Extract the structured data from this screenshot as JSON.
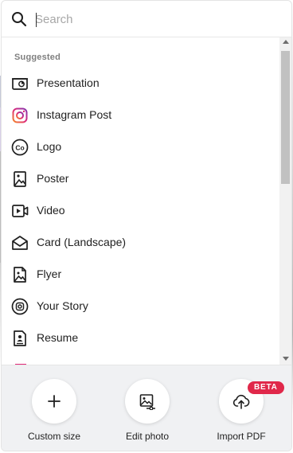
{
  "search": {
    "placeholder": "Search"
  },
  "suggested": {
    "title": "Suggested",
    "items": [
      {
        "label": "Presentation",
        "icon": "presentation-icon"
      },
      {
        "label": "Instagram Post",
        "icon": "instagram-icon"
      },
      {
        "label": "Logo",
        "icon": "logo-co-icon"
      },
      {
        "label": "Poster",
        "icon": "poster-icon"
      },
      {
        "label": "Video",
        "icon": "video-icon"
      },
      {
        "label": "Card (Landscape)",
        "icon": "card-envelope-icon"
      },
      {
        "label": "Flyer",
        "icon": "flyer-icon"
      },
      {
        "label": "Your Story",
        "icon": "story-icon"
      },
      {
        "label": "Resume",
        "icon": "resume-icon"
      }
    ]
  },
  "actions": [
    {
      "label": "Custom size",
      "icon": "plus-icon"
    },
    {
      "label": "Edit photo",
      "icon": "edit-photo-icon"
    },
    {
      "label": "Import PDF",
      "icon": "upload-cloud-icon",
      "badge": "BETA"
    }
  ],
  "colors": {
    "badge": "#e0284a",
    "instagram_gradient": [
      "#f58529",
      "#dd2a7b",
      "#8134af"
    ],
    "footer_background": "#f0f1f3"
  }
}
